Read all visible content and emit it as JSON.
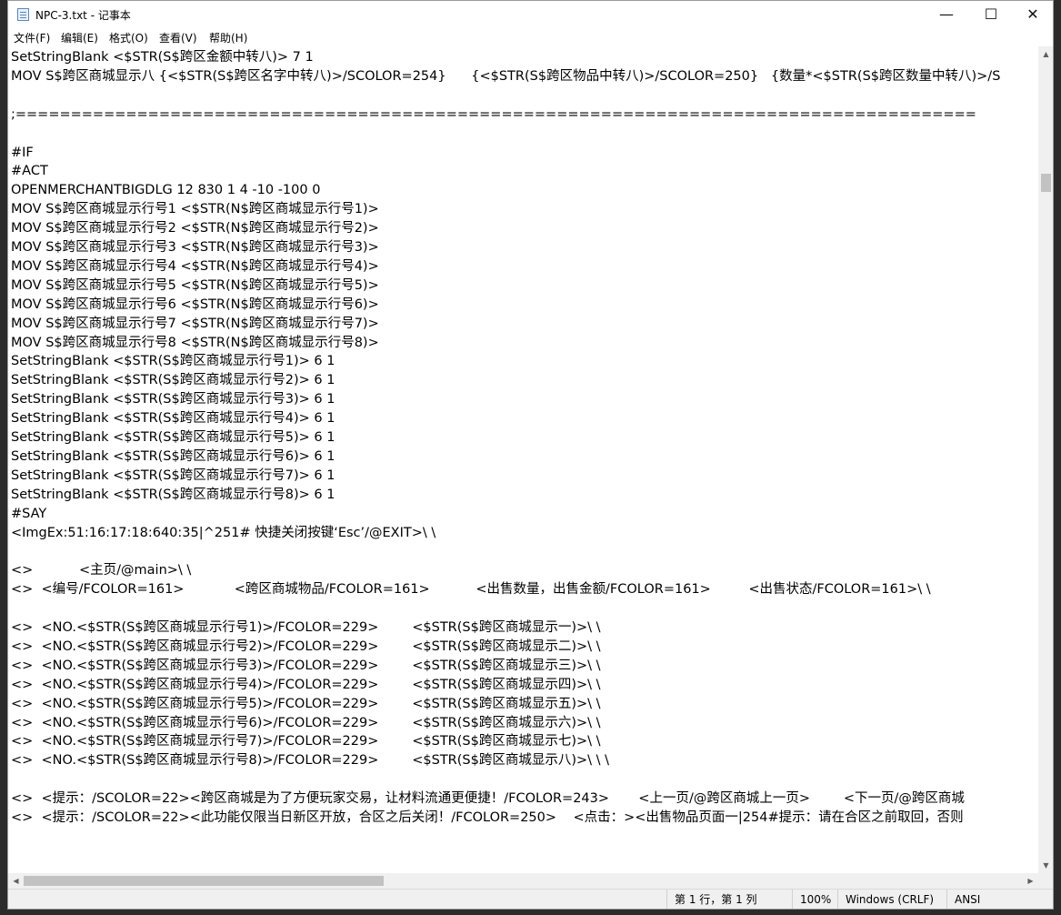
{
  "window": {
    "title": "NPC-3.txt - 记事本",
    "minimize_glyph": "—",
    "maximize_glyph": "☐",
    "close_glyph": "✕"
  },
  "menu": {
    "file": "文件(F)",
    "edit": "编辑(E)",
    "format": "格式(O)",
    "view": "查看(V)",
    "help": "帮助(H)"
  },
  "editor_lines": [
    "SetStringBlank <$STR(S$跨区金额中转八)> 7 1",
    "MOV S$跨区商城显示八 {<$STR(S$跨区名字中转八)>/SCOLOR=254}      {<$STR(S$跨区物品中转八)>/SCOLOR=250}   {数量*<$STR(S$跨区数量中转八)>/S",
    "",
    ";=======================================================================================",
    "",
    "#IF",
    "#ACT",
    "OPENMERCHANTBIGDLG 12 830 1 4 -10 -100 0",
    "MOV S$跨区商城显示行号1 <$STR(N$跨区商城显示行号1)>",
    "MOV S$跨区商城显示行号2 <$STR(N$跨区商城显示行号2)>",
    "MOV S$跨区商城显示行号3 <$STR(N$跨区商城显示行号3)>",
    "MOV S$跨区商城显示行号4 <$STR(N$跨区商城显示行号4)>",
    "MOV S$跨区商城显示行号5 <$STR(N$跨区商城显示行号5)>",
    "MOV S$跨区商城显示行号6 <$STR(N$跨区商城显示行号6)>",
    "MOV S$跨区商城显示行号7 <$STR(N$跨区商城显示行号7)>",
    "MOV S$跨区商城显示行号8 <$STR(N$跨区商城显示行号8)>",
    "SetStringBlank <$STR(S$跨区商城显示行号1)> 6 1",
    "SetStringBlank <$STR(S$跨区商城显示行号2)> 6 1",
    "SetStringBlank <$STR(S$跨区商城显示行号3)> 6 1",
    "SetStringBlank <$STR(S$跨区商城显示行号4)> 6 1",
    "SetStringBlank <$STR(S$跨区商城显示行号5)> 6 1",
    "SetStringBlank <$STR(S$跨区商城显示行号6)> 6 1",
    "SetStringBlank <$STR(S$跨区商城显示行号7)> 6 1",
    "SetStringBlank <$STR(S$跨区商城显示行号8)> 6 1",
    "#SAY",
    "<ImgEx:51:16:17:18:640:35|^251# 快捷关闭按键‘Esc’/@EXIT>\\ \\",
    "",
    "<>           <主页/@main>\\ \\",
    "<>  <编号/FCOLOR=161>            <跨区商城物品/FCOLOR=161>           <出售数量，出售金额/FCOLOR=161>         <出售状态/FCOLOR=161>\\ \\",
    "",
    "<>  <NO.<$STR(S$跨区商城显示行号1)>/FCOLOR=229>        <$STR(S$跨区商城显示一)>\\ \\",
    "<>  <NO.<$STR(S$跨区商城显示行号2)>/FCOLOR=229>        <$STR(S$跨区商城显示二)>\\ \\",
    "<>  <NO.<$STR(S$跨区商城显示行号3)>/FCOLOR=229>        <$STR(S$跨区商城显示三)>\\ \\",
    "<>  <NO.<$STR(S$跨区商城显示行号4)>/FCOLOR=229>        <$STR(S$跨区商城显示四)>\\ \\",
    "<>  <NO.<$STR(S$跨区商城显示行号5)>/FCOLOR=229>        <$STR(S$跨区商城显示五)>\\ \\",
    "<>  <NO.<$STR(S$跨区商城显示行号6)>/FCOLOR=229>        <$STR(S$跨区商城显示六)>\\ \\",
    "<>  <NO.<$STR(S$跨区商城显示行号7)>/FCOLOR=229>        <$STR(S$跨区商城显示七)>\\ \\",
    "<>  <NO.<$STR(S$跨区商城显示行号8)>/FCOLOR=229>        <$STR(S$跨区商城显示八)>\\ \\ \\",
    "",
    "<>  <提示：/SCOLOR=22><跨区商城是为了方便玩家交易，让材料流通更便捷！/FCOLOR=243>       <上一页/@跨区商城上一页>        <下一页/@跨区商城",
    "<>  <提示：/SCOLOR=22><此功能仅限当日新区开放，合区之后关闭！/FCOLOR=250>    <点击：><出售物品页面一|254#提示：请在合区之前取回，否则"
  ],
  "status": {
    "position": "第 1 行，第 1 列",
    "zoom": "100%",
    "line_ending": "Windows (CRLF)",
    "encoding": "ANSI"
  }
}
